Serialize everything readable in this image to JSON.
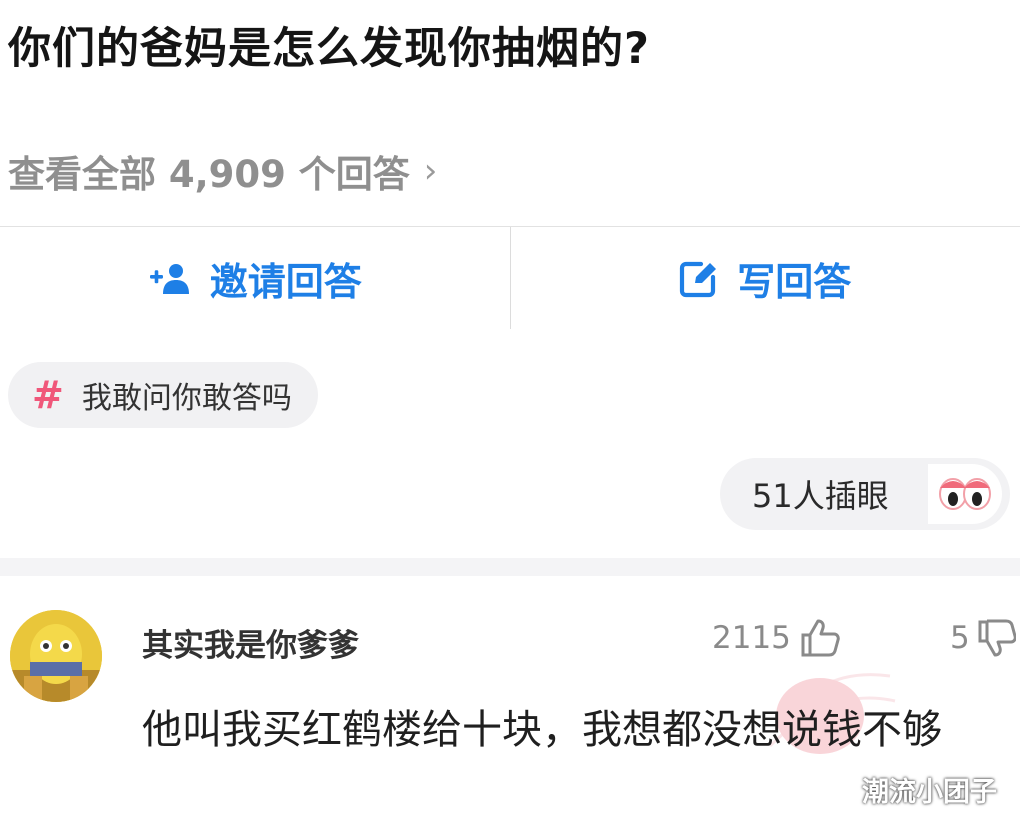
{
  "question": {
    "title": "你们的爸妈是怎么发现你抽烟的?",
    "view_all_label": "查看全部 4,909 个回答",
    "view_all_chevron": "›"
  },
  "actions": {
    "invite_label": "邀请回答",
    "write_label": "写回答",
    "accent_color": "#1e7fe6"
  },
  "topic": {
    "hash": "#",
    "label": "我敢问你敢答吗",
    "hash_color": "#f0577a"
  },
  "watchers": {
    "label": "51人插眼",
    "icon": "eyes-icon"
  },
  "comment": {
    "username": "其实我是你爹爹",
    "likes": "2115",
    "dislikes": "5",
    "text": "他叫我买红鹤楼给十块，我想都没想说钱不够"
  },
  "watermark": "潮流小团子"
}
